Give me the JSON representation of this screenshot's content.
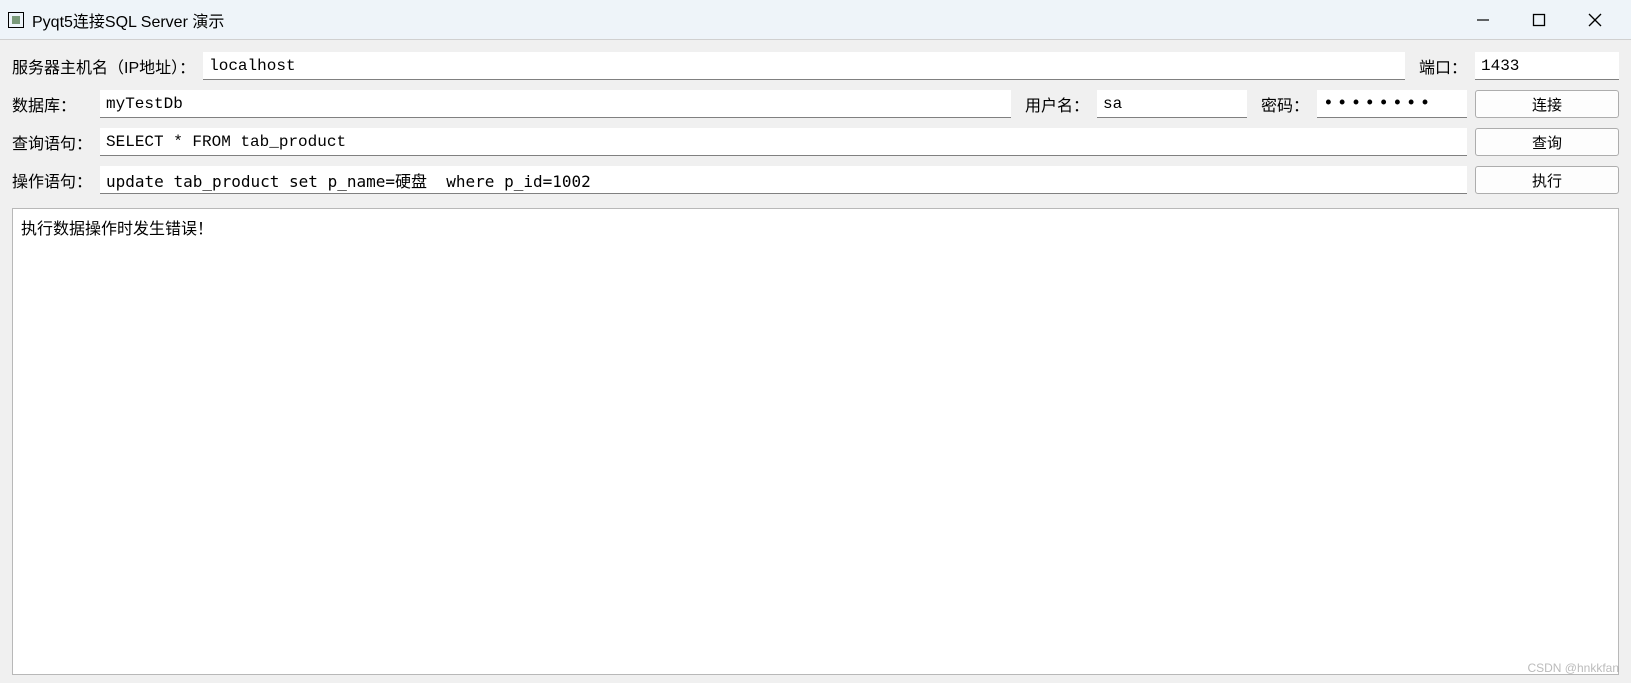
{
  "window": {
    "title": "Pyqt5连接SQL Server 演示"
  },
  "row1": {
    "host_label": "服务器主机名（IP地址）：",
    "host_value": "localhost",
    "port_label": "端口：",
    "port_value": "1433"
  },
  "row2": {
    "db_label": "数据库：",
    "db_value": "myTestDb",
    "user_label": "用户名：",
    "user_value": "sa",
    "pass_label": "密码：",
    "pass_value": "••••••••",
    "connect_btn": "连接"
  },
  "row3": {
    "query_label": "查询语句：",
    "query_value": "SELECT * FROM tab_product",
    "query_btn": "查询"
  },
  "row4": {
    "op_label": "操作语句：",
    "op_value": "update tab_product set p_name=硬盘  where p_id=1002",
    "exec_btn": "执行"
  },
  "output": {
    "text": "执行数据操作时发生错误！"
  },
  "watermark": "CSDN @hnkkfan"
}
